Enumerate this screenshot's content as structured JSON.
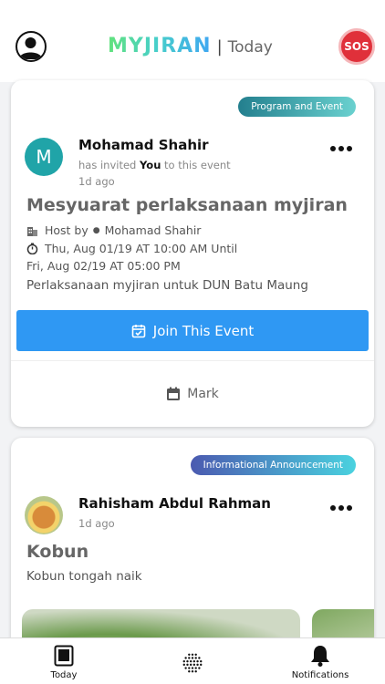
{
  "header": {
    "brand": "MYJIRAN",
    "separator": "|",
    "subtitle": "Today",
    "sos_label": "SOS"
  },
  "posts": [
    {
      "category": "Program and Event",
      "avatar_letter": "M",
      "author": "Mohamad Shahir",
      "invite_prefix": "has invited",
      "invite_you": "You",
      "invite_suffix": "to this event",
      "time_ago": "1d ago",
      "title": "Mesyuarat perlaksanaan myjiran",
      "host_label": "Host by",
      "host_name": "Mohamad Shahir",
      "date_line1": "Thu, Aug 01/19 AT 10:00 AM Until",
      "date_line2": "Fri, Aug 02/19 AT 05:00 PM",
      "description": "Perlaksanaan myjiran untuk DUN Batu Maung",
      "join_label": "Join This Event",
      "mark_label": "Mark"
    },
    {
      "category": "Informational Announcement",
      "author": "Rahisham Abdul Rahman",
      "time_ago": "1d ago",
      "title": "Kobun",
      "description": "Kobun tongah naik"
    }
  ],
  "tabbar": {
    "today_label": "Today",
    "notifications_label": "Notifications"
  },
  "colors": {
    "primary_button": "#2f98f3",
    "sos": "#e0303a",
    "avatar_teal": "#20a4a8"
  },
  "icons": {
    "profile": "user-circle-icon",
    "sos": "sos-icon",
    "more": "ellipsis-icon",
    "host": "building-icon",
    "time": "stopwatch-icon",
    "calendar": "calendar-check-icon",
    "mark": "calendar-icon",
    "today_tab": "tablet-icon",
    "mid_tab": "dot-grid-icon",
    "notifications_tab": "bell-icon"
  }
}
